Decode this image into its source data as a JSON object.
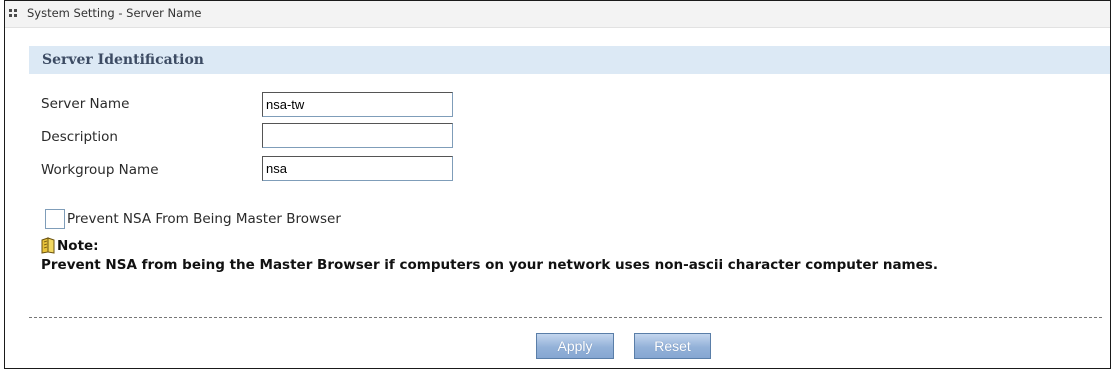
{
  "window": {
    "title": "System Setting - Server Name"
  },
  "section": {
    "title": "Server Identification"
  },
  "fields": {
    "server_name": {
      "label": "Server Name",
      "value": "nsa-tw"
    },
    "description": {
      "label": "Description",
      "value": ""
    },
    "workgroup_name": {
      "label": "Workgroup Name",
      "value": "nsa"
    }
  },
  "master_browser": {
    "label": "Prevent NSA From Being Master Browser",
    "checked": false
  },
  "note": {
    "label": "Note:",
    "text": "Prevent NSA from being the Master Browser if computers on your network uses non-ascii character computer names."
  },
  "buttons": {
    "apply": "Apply",
    "reset": "Reset"
  },
  "colors": {
    "section_background": "#dce9f5",
    "section_title": "#3c4b63",
    "button_fill": "#93b1d8"
  },
  "icons": {
    "title": "grid-dots-icon",
    "note": "note-book-icon"
  }
}
